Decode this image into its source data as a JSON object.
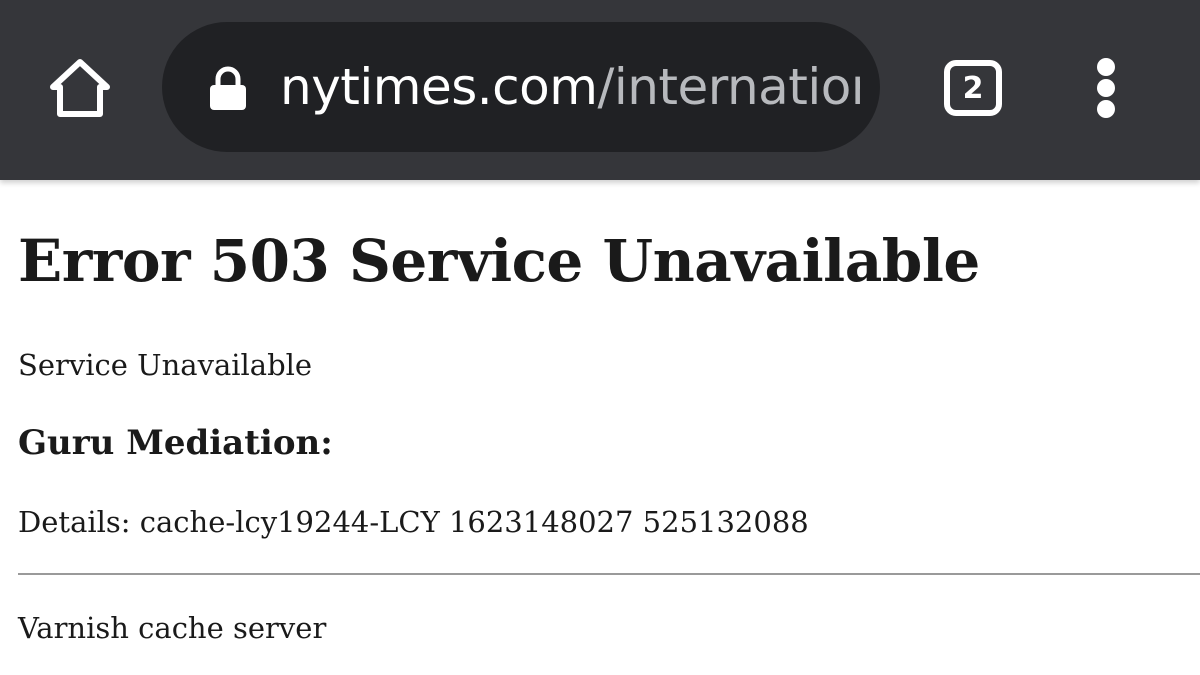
{
  "browser": {
    "url_domain": "nytimes.com",
    "url_path": "/internatior",
    "tab_count": "2",
    "icons": {
      "home": "home-icon",
      "lock": "lock-icon",
      "tabs": "tab-switcher-icon",
      "menu": "more-vert-icon"
    },
    "colors": {
      "toolbar": "#35363a",
      "omnibox": "#202124",
      "url_domain": "#ffffff",
      "url_path": "#b7b9bd"
    }
  },
  "page": {
    "heading": "Error 503 Service Unavailable",
    "status_text": "Service Unavailable",
    "subheading": "Guru Mediation:",
    "details": "Details: cache-lcy19244-LCY 1623148027 525132088",
    "footer": "Varnish cache server"
  }
}
